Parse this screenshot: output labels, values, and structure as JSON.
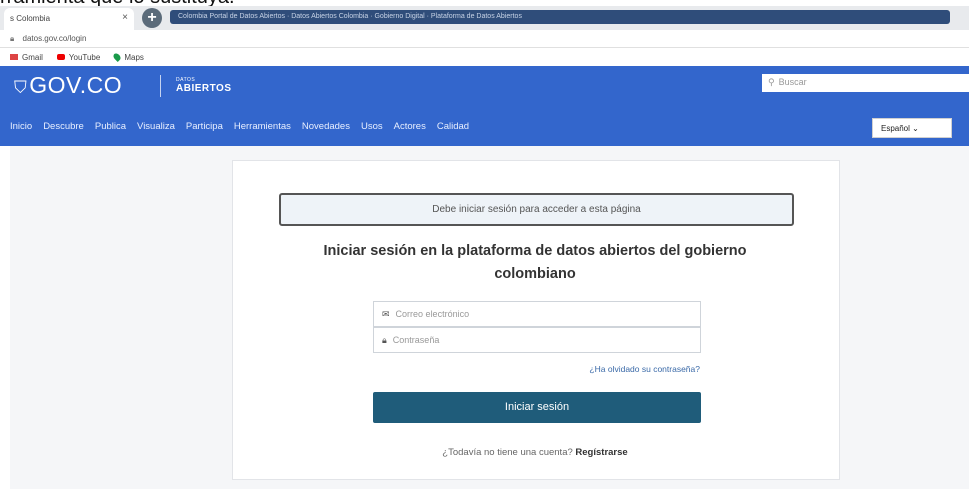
{
  "caption": "rramienta que lo sustituya.",
  "browser": {
    "tab_label": "s Colombia",
    "tab_close": "×",
    "new_tab": "+",
    "window_title": "Colombia Portal de Datos Abiertos · Datos Abiertos Colombia · Gobierno Digital · Plataforma de Datos Abiertos",
    "url": "datos.gov.co/login",
    "bookmarks": [
      "Gmail",
      "YouTube",
      "Maps"
    ]
  },
  "header": {
    "gov_logo": "GOV.CO",
    "datos_small": "DATOS",
    "datos_logo": "ABIERTOS",
    "search_placeholder": "Buscar"
  },
  "nav": {
    "items": [
      "Inicio",
      "Descubre",
      "Publica",
      "Visualiza",
      "Participa",
      "Herramientas",
      "Novedades",
      "Usos",
      "Actores",
      "Calidad"
    ],
    "language": "Español ⌄"
  },
  "login": {
    "alert": "Debe iniciar sesión para acceder a esta página",
    "title": "Iniciar sesión en la plataforma de datos abiertos del gobierno colombiano",
    "email_placeholder": "Correo electrónico",
    "password_placeholder": "Contraseña",
    "forgot": "¿Ha olvidado su contraseña?",
    "submit": "Iniciar sesión",
    "no_account": "¿Todavía no tiene una cuenta?",
    "register": "Regístrarse"
  }
}
